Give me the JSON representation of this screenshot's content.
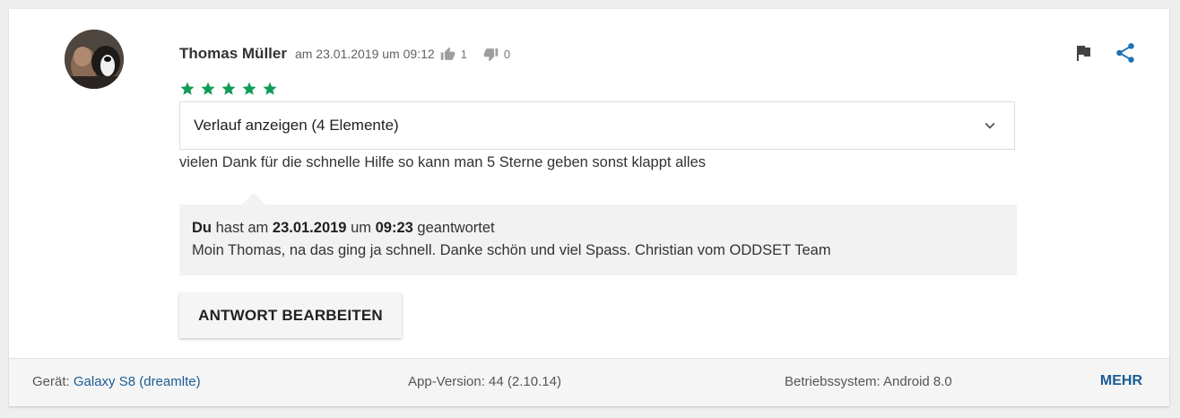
{
  "review": {
    "author": "Thomas Müller",
    "date": "am 23.01.2019 um 09:12",
    "thumbs_up_count": "1",
    "thumbs_down_count": "0",
    "rating": 5,
    "star_color": "#0f9d58",
    "history_label": "Verlauf anzeigen (4 Elemente)",
    "text": "vielen Dank für die schnelle Hilfe so kann man 5 Sterne geben sonst klappt alles",
    "icons": [
      "avatar",
      "thumbs-up-icon",
      "thumbs-down-icon",
      "flag-icon",
      "share-icon",
      "star-icon",
      "chevron-down-icon"
    ]
  },
  "reply": {
    "who": "Du",
    "text_a": "hast am",
    "date": "23.01.2019",
    "text_b": "um",
    "time": "09:23",
    "text_c": "geantwortet",
    "message": "Moin Thomas, na das ging ja schnell. Danke schön und viel Spass. Christian vom ODDSET Team"
  },
  "edit_button_label": "ANTWORT BEARBEITEN",
  "footer": {
    "device_label": "Gerät:",
    "device_value": "Galaxy S8 (dreamlte)",
    "app_version": "App-Version: 44 (2.10.14)",
    "os": "Betriebssystem: Android 8.0",
    "more_label": "MEHR"
  },
  "colors": {
    "link": "#1a5c96",
    "share_icon": "#1a73b8",
    "icon_grey": "#9e9e9e"
  }
}
